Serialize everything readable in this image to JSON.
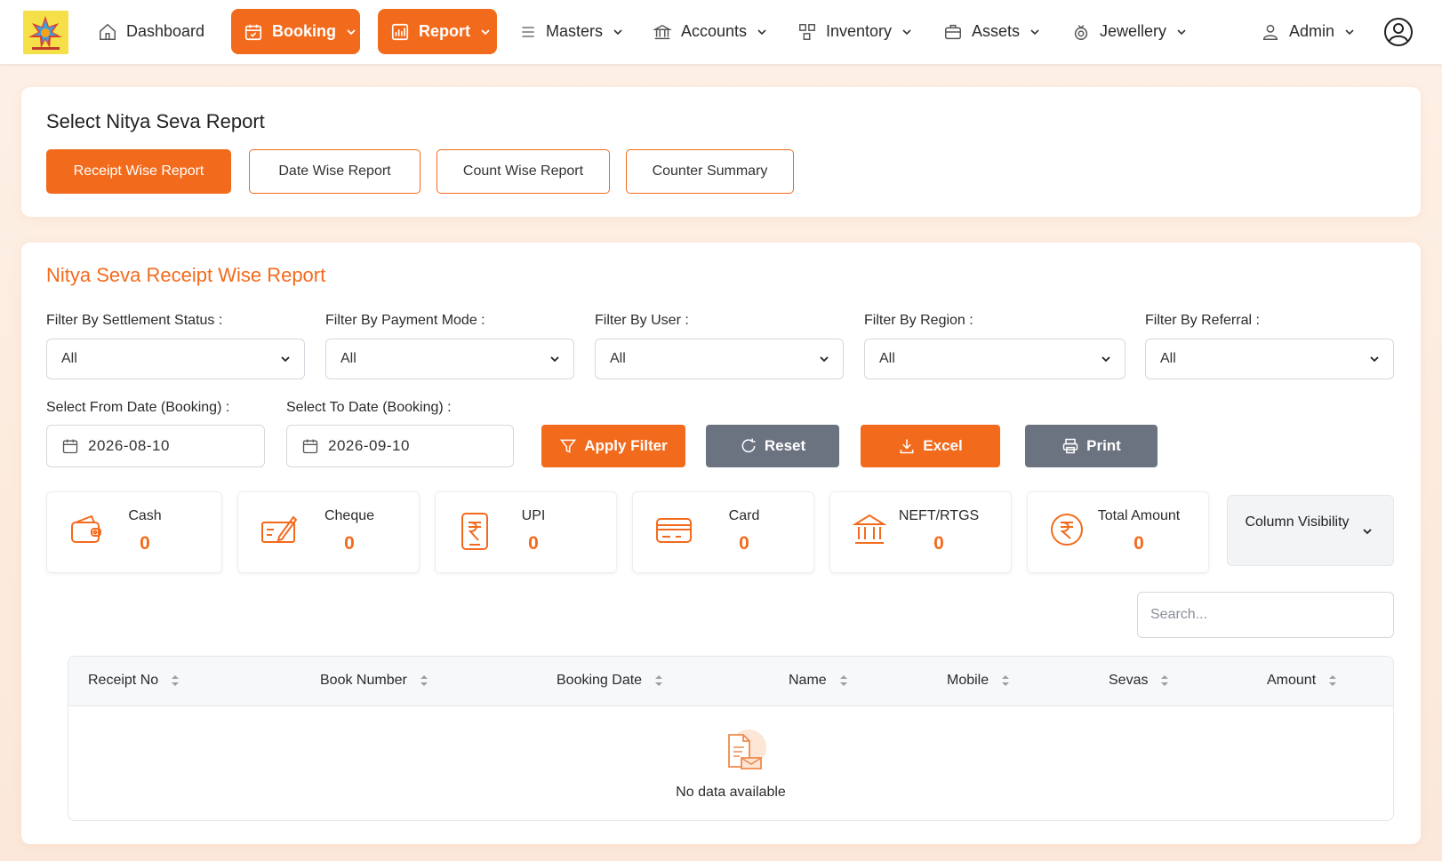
{
  "nav": {
    "items": [
      {
        "label": "Dashboard",
        "icon": "home-icon",
        "active": false,
        "dropdown": false
      },
      {
        "label": "Booking",
        "icon": "calendar-icon",
        "active": true,
        "dropdown": true
      },
      {
        "label": "Report",
        "icon": "report-icon",
        "active": true,
        "dropdown": true
      },
      {
        "label": "Masters",
        "icon": "list-icon",
        "active": false,
        "dropdown": true
      },
      {
        "label": "Accounts",
        "icon": "bank-icon",
        "active": false,
        "dropdown": true
      },
      {
        "label": "Inventory",
        "icon": "grid-icon",
        "active": false,
        "dropdown": true
      },
      {
        "label": "Assets",
        "icon": "briefcase-icon",
        "active": false,
        "dropdown": true
      },
      {
        "label": "Jewellery",
        "icon": "ring-icon",
        "active": false,
        "dropdown": true
      }
    ],
    "admin_label": "Admin"
  },
  "report_select": {
    "title": "Select Nitya Seva Report",
    "tabs": [
      "Receipt Wise Report",
      "Date Wise Report",
      "Count Wise Report",
      "Counter Summary"
    ],
    "active_tab": "Receipt Wise Report"
  },
  "report": {
    "title": "Nitya Seva Receipt Wise Report",
    "filters": [
      {
        "label": "Filter By Settlement Status :",
        "value": "All"
      },
      {
        "label": "Filter By Payment Mode :",
        "value": "All"
      },
      {
        "label": "Filter By User :",
        "value": "All"
      },
      {
        "label": "Filter By Region :",
        "value": "All"
      },
      {
        "label": "Filter By Referral :",
        "value": "All"
      }
    ],
    "from_date": {
      "label": "Select From Date (Booking) :",
      "value": "2026-08-10"
    },
    "to_date": {
      "label": "Select To Date (Booking) :",
      "value": "2026-09-10"
    },
    "buttons": {
      "apply": "Apply Filter",
      "reset": "Reset",
      "excel": "Excel",
      "print": "Print"
    },
    "stats": [
      {
        "label": "Cash",
        "value": "0",
        "icon": "wallet-icon"
      },
      {
        "label": "Cheque",
        "value": "0",
        "icon": "cheque-icon"
      },
      {
        "label": "UPI",
        "value": "0",
        "icon": "upi-icon"
      },
      {
        "label": "Card",
        "value": "0",
        "icon": "card-icon"
      },
      {
        "label": "NEFT/RTGS",
        "value": "0",
        "icon": "bank-icon"
      },
      {
        "label": "Total Amount",
        "value": "0",
        "icon": "rupee-icon"
      }
    ],
    "column_visibility": "Column Visibility",
    "search_placeholder": "Search...",
    "columns": [
      "Receipt No",
      "Book Number",
      "Booking Date",
      "Name",
      "Mobile",
      "Sevas",
      "Amount"
    ],
    "empty_text": "No data available"
  },
  "colors": {
    "accent": "#f26b1d",
    "gray_button": "#6b7380"
  }
}
